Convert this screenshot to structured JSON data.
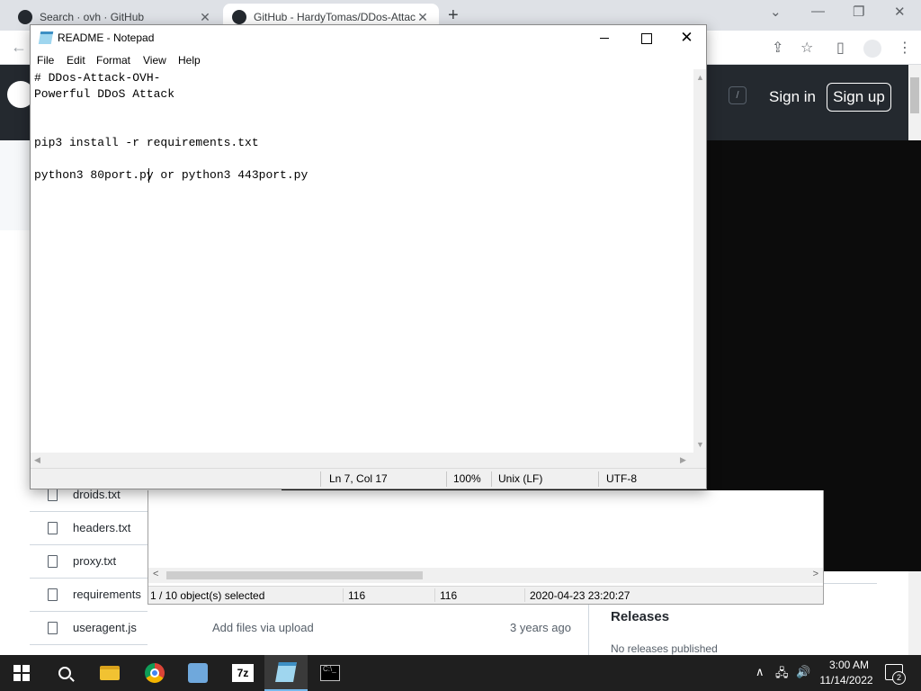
{
  "browser": {
    "tabs": [
      {
        "title": "Search · ovh · GitHub",
        "icon": "github-icon",
        "close": "✕"
      },
      {
        "title": "GitHub - HardyTomas/DDos-Attac",
        "icon": "github-icon",
        "close": "✕"
      }
    ],
    "new_tab": "+",
    "window_controls": {
      "chevron": "⌄",
      "minimize": "—",
      "restore": "❐",
      "close": "✕"
    },
    "back": "←",
    "toolbar_icons": {
      "share": "⇪",
      "star": "☆",
      "sidepanel": "▯",
      "profile": "👤",
      "menu": "⋮"
    }
  },
  "github": {
    "slash_key": "/",
    "sign_in": "Sign in",
    "sign_up": "Sign up",
    "files": [
      "droids.txt",
      "headers.txt",
      "proxy.txt",
      "requirements",
      "useragent.js"
    ],
    "commit_message": "Add files via upload",
    "commit_age": "3 years ago",
    "releases_heading": "Releases",
    "no_releases": "No releases published"
  },
  "sevenzip": {
    "status": {
      "selected": "1 / 10 object(s) selected",
      "size": "116",
      "packed": "116",
      "modified": "2020-04-23 23:20:27"
    },
    "scroll_left": "<",
    "scroll_right": ">"
  },
  "notepad": {
    "title": "README - Notepad",
    "close": "✕",
    "menu": [
      "File",
      "Edit",
      "Format",
      "View",
      "Help"
    ],
    "lines": [
      "# DDos-Attack-OVH-",
      "Powerful DDoS Attack",
      "",
      "",
      "pip3 install -r requirements.txt",
      "",
      "python3 80port.py or python3 443port.py"
    ],
    "status": {
      "position": "Ln 7, Col 17",
      "zoom": "100%",
      "line_ending": "Unix (LF)",
      "encoding": "UTF-8"
    }
  },
  "taskbar": {
    "apps": [
      "start",
      "search",
      "file-explorer",
      "chrome",
      "tools",
      "7-zip",
      "notepad",
      "command-prompt"
    ],
    "sevenzip_label": "7z",
    "cmd_label": "C:\\_",
    "tray": {
      "chevron": "∧",
      "network": "🖧",
      "volume": "🔊"
    },
    "time": "3:00 AM",
    "date": "11/14/2022",
    "notification_count": "2"
  }
}
